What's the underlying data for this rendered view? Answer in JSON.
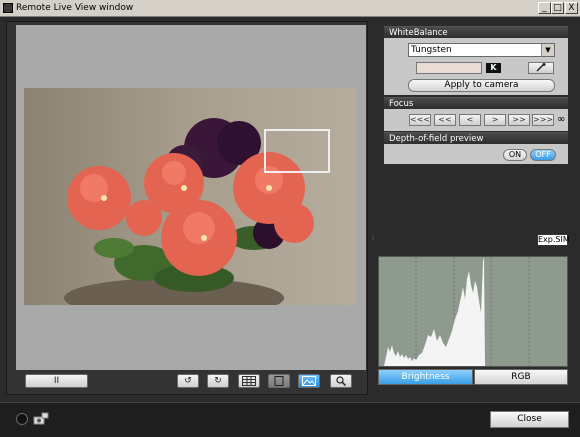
{
  "window": {
    "title": "Remote Live View window",
    "minimize": "_",
    "maximize": "□",
    "close": "X"
  },
  "white_balance": {
    "header": "WhiteBalance",
    "selected": "Tungsten",
    "kelvin_badge": "K",
    "apply_label": "Apply to camera"
  },
  "focus": {
    "header": "Focus",
    "buttons": [
      "<<<",
      "<<",
      "<",
      ">",
      ">>",
      ">>>"
    ],
    "infinity": "∞"
  },
  "dof": {
    "header": "Depth-of-field preview",
    "on_label": "ON",
    "off_label": "OFF",
    "state": "OFF"
  },
  "exp_sim": "Exp.SIM",
  "histogram": {
    "brightness_label": "Brightness",
    "rgb_label": "RGB",
    "active_tab": "Brightness"
  },
  "toolbar": {
    "pause_label": "II",
    "rotate_left": "↺",
    "rotate_right": "↻",
    "grid": "grid",
    "aspect": "aspect",
    "focus_frame": "focus-frame",
    "zoom": "zoom"
  },
  "footer": {
    "close_label": "Close"
  }
}
